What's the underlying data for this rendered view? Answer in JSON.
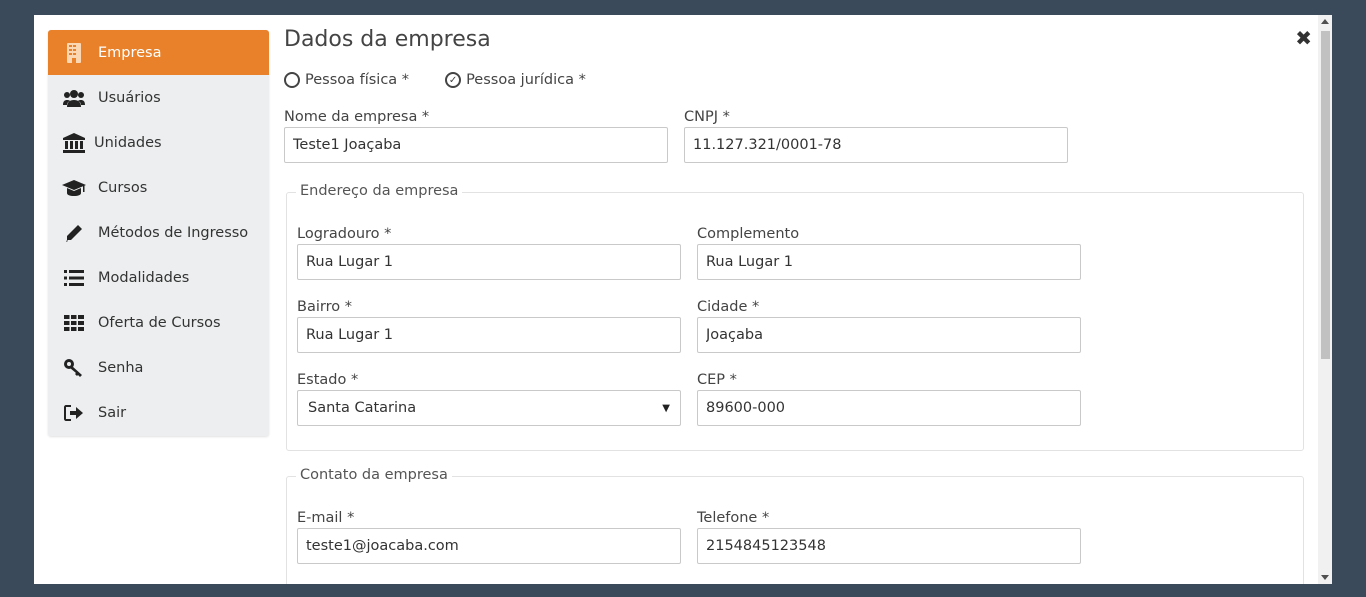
{
  "sidebar": {
    "items": [
      {
        "label": "Empresa",
        "icon": "building-icon",
        "active": true
      },
      {
        "label": "Usuários",
        "icon": "users-icon"
      },
      {
        "label": "Unidades",
        "icon": "bank-icon"
      },
      {
        "label": "Cursos",
        "icon": "graduation-cap-icon"
      },
      {
        "label": "Métodos de Ingresso",
        "icon": "pencil-icon"
      },
      {
        "label": "Modalidades",
        "icon": "list-icon"
      },
      {
        "label": "Oferta de Cursos",
        "icon": "grid-icon"
      },
      {
        "label": "Senha",
        "icon": "key-icon"
      },
      {
        "label": "Sair",
        "icon": "sign-out-icon"
      }
    ]
  },
  "colors": {
    "accent": "#e8812a",
    "backdrop": "#3b4a5a"
  },
  "form": {
    "title": "Dados da empresa",
    "close_label": "✖",
    "radio_fisica": "Pessoa física *",
    "radio_juridica": "Pessoa jurídica *",
    "selected_person_type": "Pessoa jurídica *",
    "nome_label": "Nome da empresa *",
    "nome_value": "Teste1 Joaçaba",
    "cnpj_label": "CNPJ *",
    "cnpj_value": "11.127.321/0001-78",
    "endereco": {
      "legend": "Endereço da empresa",
      "logradouro_label": "Logradouro *",
      "logradouro_value": "Rua Lugar 1",
      "complemento_label": "Complemento",
      "complemento_value": "Rua Lugar 1",
      "bairro_label": "Bairro *",
      "bairro_value": "Rua Lugar 1",
      "cidade_label": "Cidade *",
      "cidade_value": "Joaçaba",
      "estado_label": "Estado *",
      "estado_value": "Santa Catarina",
      "cep_label": "CEP *",
      "cep_value": "89600-000"
    },
    "contato": {
      "legend": "Contato da empresa",
      "email_label": "E-mail *",
      "email_value": "teste1@joacaba.com",
      "telefone_label": "Telefone *",
      "telefone_value": "2154845123548"
    }
  }
}
